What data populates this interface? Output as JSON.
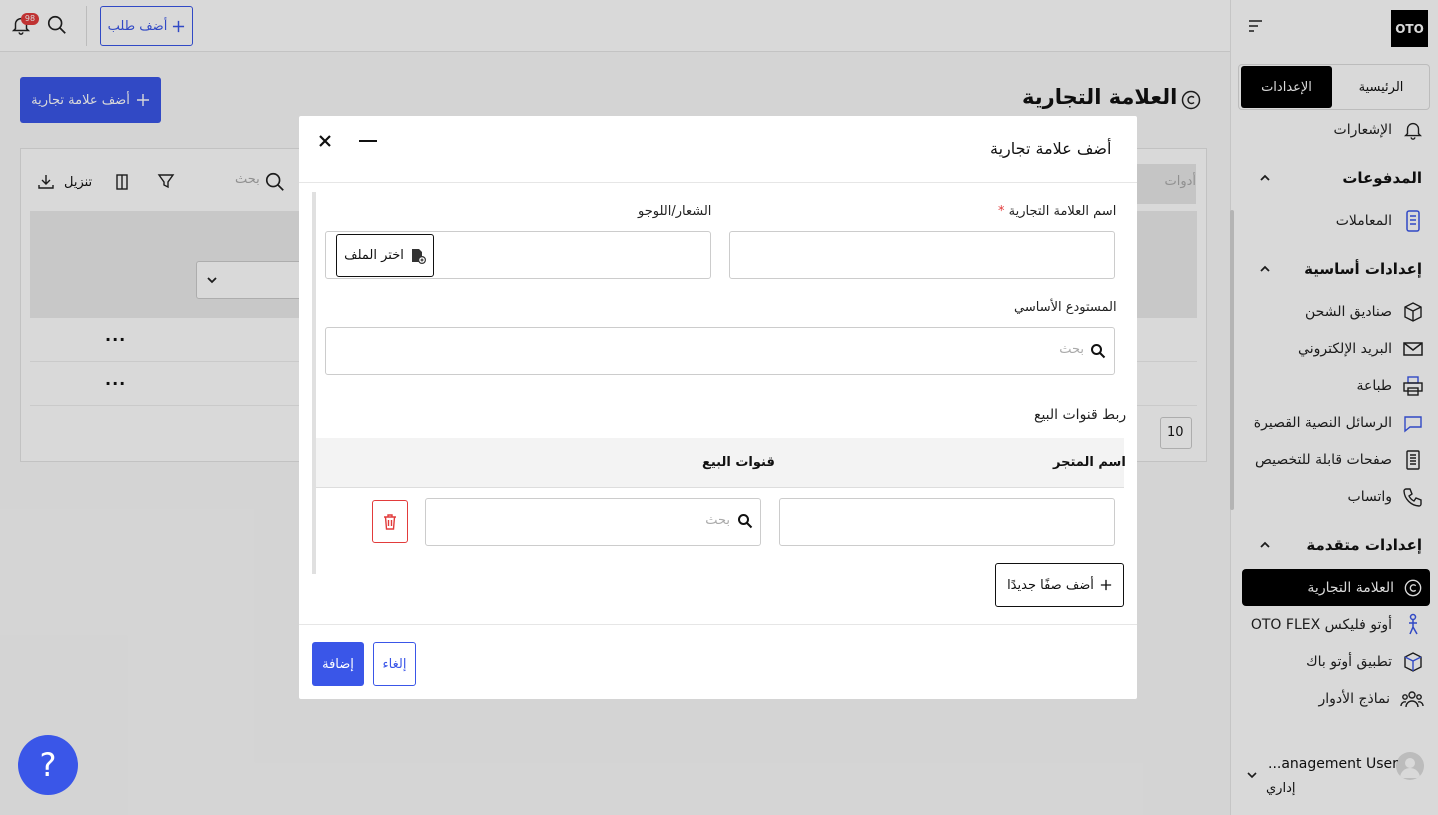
{
  "topbar": {
    "notification_count": "98",
    "add_order_label": "أضف طلب"
  },
  "page": {
    "title": "العلامة التجارية",
    "add_brand_label": "أضف علامة تجارية",
    "card": {
      "download_label": "تنزيل",
      "search_label": "بحث",
      "tools_label": "أدوات",
      "row_actions": "...",
      "page_size": "10"
    }
  },
  "sidebar": {
    "logo": "OTO",
    "tabs": {
      "settings": "الإعدادات",
      "home": "الرئيسية"
    },
    "notifications": "الإشعارات",
    "sections": {
      "payments": "المدفوعات",
      "basic": "إعدادات أساسية",
      "advanced": "إعدادات متقدمة"
    },
    "items": {
      "transactions": "المعاملات",
      "shipping_boxes": "صناديق الشحن",
      "email": "البريد الإلكتروني",
      "printing": "طباعة",
      "sms": "الرسائل النصية القصيرة",
      "custom_pages": "صفحات قابلة للتخصيص",
      "whatsapp": "واتساب",
      "brand": "العلامة التجارية",
      "oto_flex": "أوتو فليكس OTO FLEX",
      "otopack_app": "تطبيق أوتو باك",
      "role_templates": "نماذج الأدوار"
    },
    "user": {
      "name": "...anagement User",
      "role": "إداري"
    }
  },
  "modal": {
    "title": "أضف علامة تجارية",
    "brand_name_label": "اسم العلامة التجارية",
    "required_mark": "*",
    "logo_label": "الشعار/اللوجو",
    "choose_file": "اختر الملف",
    "main_warehouse_label": "المستودع الأساسي",
    "search_placeholder": "بحث",
    "link_channels_label": "ربط قنوات البيع",
    "columns": {
      "store_name": "اسم المتجر",
      "sales_channels": "قنوات البيع"
    },
    "add_row_label": "أضف صفًا جديدًا",
    "cancel_label": "إلغاء",
    "submit_label": "إضافة"
  },
  "help_label": "?",
  "colors": {
    "primary": "#3a56e8",
    "danger": "#e23b3b",
    "active_nav": "#000000"
  }
}
